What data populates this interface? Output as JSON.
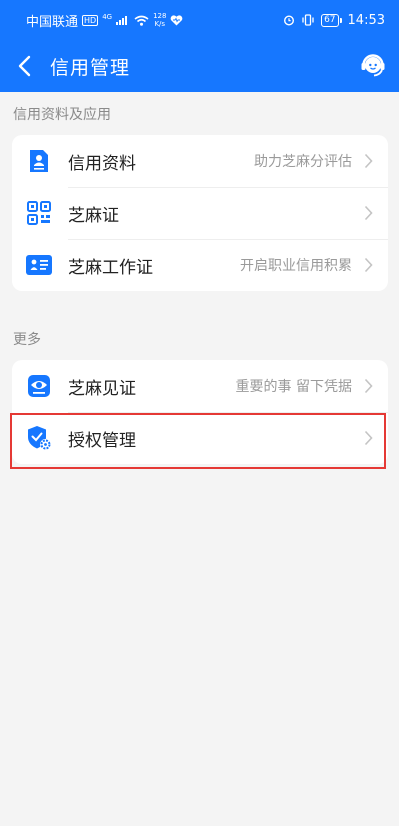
{
  "status_bar": {
    "carrier": "中国联通",
    "hd": "HD",
    "network": "4G",
    "speed_value": "128",
    "speed_unit": "K/s",
    "battery": "67",
    "time": "14:53"
  },
  "header": {
    "title": "信用管理",
    "back_icon": "chevron-left-icon",
    "service_icon": "customer-service-icon"
  },
  "sections": [
    {
      "title": "信用资料及应用",
      "items": [
        {
          "label": "信用资料",
          "sub": "助力芝麻分评估",
          "icon": "profile-doc-icon"
        },
        {
          "label": "芝麻证",
          "sub": "",
          "icon": "qrcode-icon"
        },
        {
          "label": "芝麻工作证",
          "sub": "开启职业信用积累",
          "icon": "work-card-icon"
        }
      ]
    },
    {
      "title": "更多",
      "items": [
        {
          "label": "芝麻见证",
          "sub": "重要的事 留下凭据",
          "icon": "witness-eye-icon"
        },
        {
          "label": "授权管理",
          "sub": "",
          "icon": "shield-gear-icon"
        }
      ]
    }
  ],
  "colors": {
    "brand": "#1677ff",
    "highlight": "#e53935",
    "background": "#f4f4f4"
  }
}
